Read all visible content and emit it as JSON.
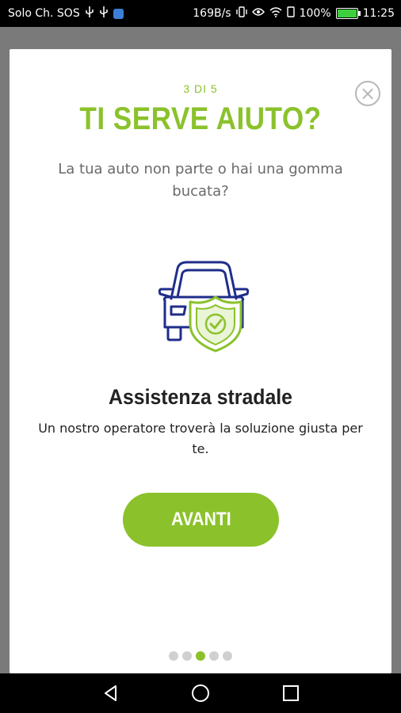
{
  "status_bar": {
    "left_text": "Solo Ch. SOS",
    "speed": "169B/s",
    "battery": "100%",
    "time": "11:25"
  },
  "modal": {
    "step": "3 DI 5",
    "title": "TI SERVE AIUTO?",
    "subtitle": "La tua auto non parte o hai una gomma bucata?",
    "feature_title": "Assistenza stradale",
    "feature_desc": "Un nostro operatore troverà la soluzione giusta per te.",
    "cta_label": "AVANTI",
    "pagination": {
      "total": 5,
      "current": 3
    }
  },
  "colors": {
    "accent": "#8bc22c",
    "icon_blue": "#1f2d8a"
  },
  "icons": [
    "usb-icon",
    "app-icon",
    "vibrate-icon",
    "eye-icon",
    "wifi-icon",
    "battery-icon",
    "close-icon",
    "car-shield-icon",
    "back-icon",
    "home-icon",
    "recents-icon"
  ]
}
